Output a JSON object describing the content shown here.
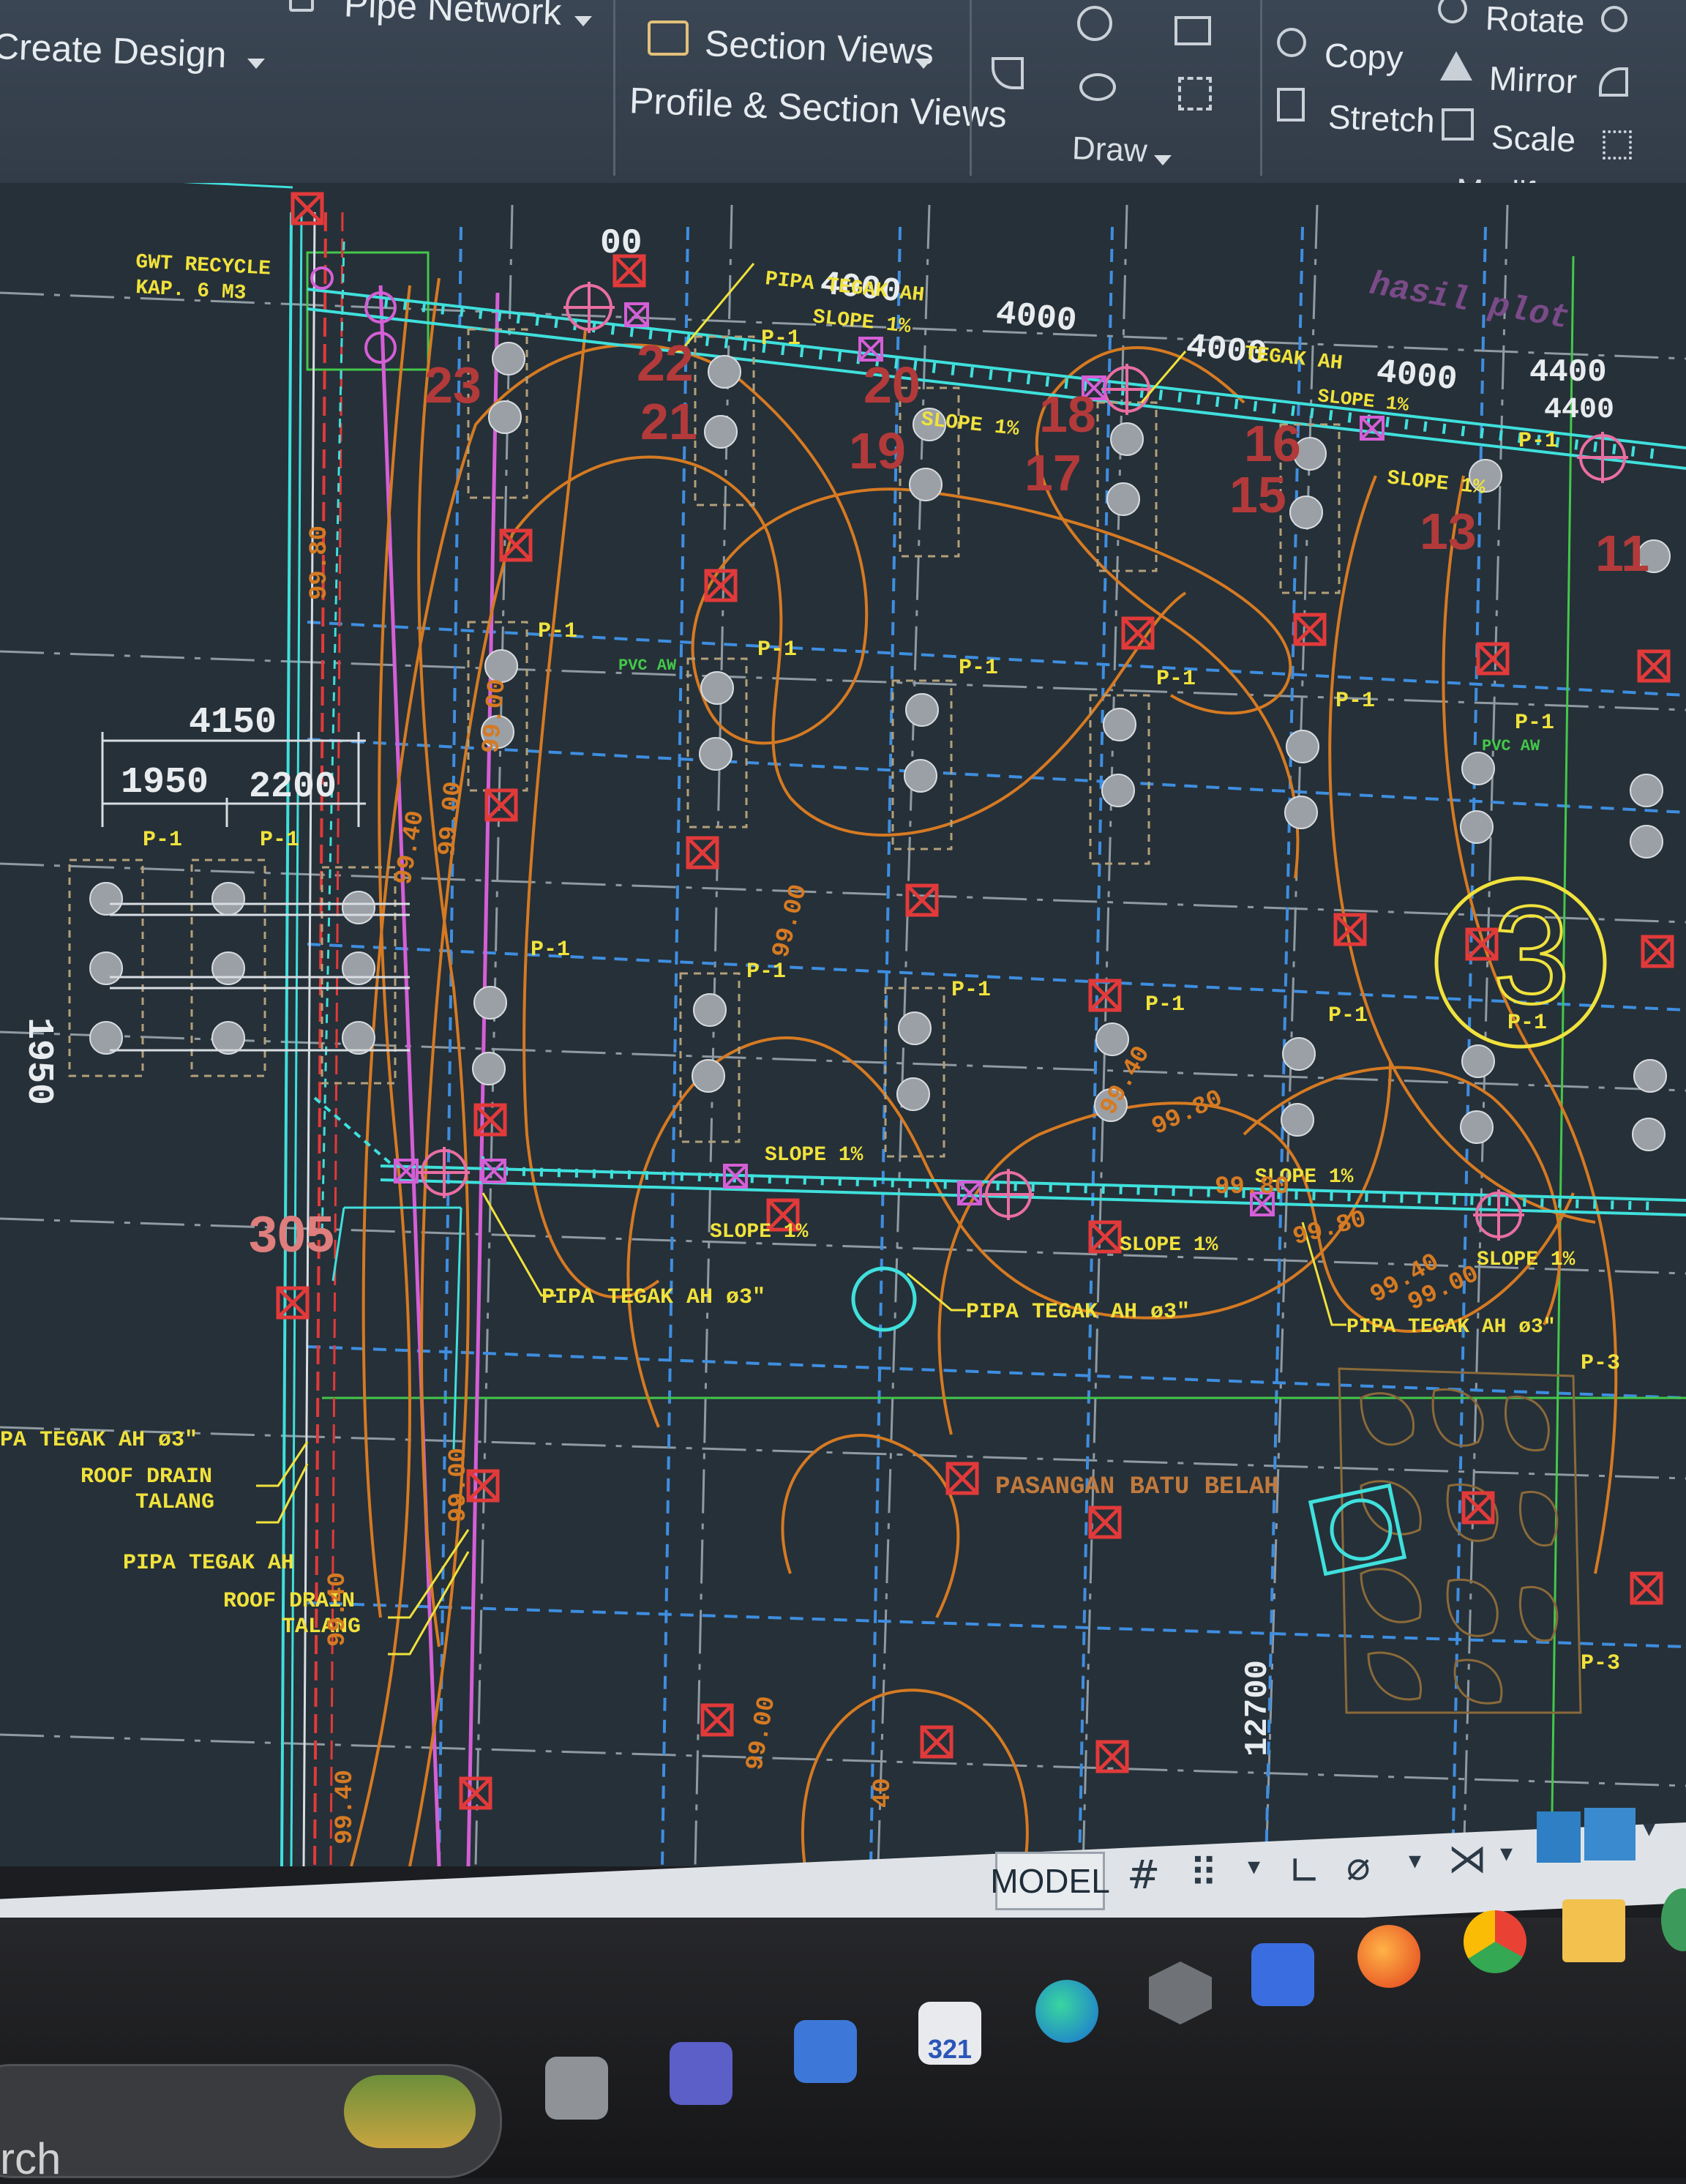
{
  "ribbon": {
    "create_design": "Create Design",
    "pipe_network": "Pipe Network",
    "section_views": "Section Views",
    "profile_section_views": "Profile & Section Views",
    "draw_panel": "Draw",
    "copy": "Copy",
    "stretch": "Stretch",
    "rotate": "Rotate",
    "mirror": "Mirror",
    "scale": "Scale",
    "modify_panel": "Modify"
  },
  "drawing": {
    "gwt_label_1": "GWT RECYCLE",
    "gwt_label_2": "KAP. 6 M3",
    "dim_4150": "4150",
    "dim_1950": "1950",
    "dim_2200": "2200",
    "dim_1950_vertical": "1950",
    "dim_4000_a": "4000",
    "dim_4000_b": "4000",
    "dim_4000_c": "4000",
    "dim_4000_d": "4000",
    "dim_4400": "4400",
    "dim_4400_b": "4400",
    "dim_12700": "12700",
    "top_pipe_label": "PIPA TEGAK AH",
    "top_pipe_label_2": "TEGAK AH",
    "slope_1": "SLOPE 1%",
    "slope_2": "SLOPE 1%",
    "slope_3": "SLOPE 1%",
    "slope_4": "SLOPE 1%",
    "slope_5": "SLOPE 1%",
    "slope_6": "SLOPE 1%",
    "slope_7": "SLOPE 1%",
    "slope_8": "SLOPE 1%",
    "slope_9": "SLOPE 1%",
    "pipa_tegak_1": "PIPA TEGAK AH ø3\"",
    "pipa_tegak_2": "PIPA TEGAK AH ø3\"",
    "pipa_tegak_3": "PIPA TEGAK AH ø3\"",
    "pipa_tegak_left": "PA TEGAK AH ø3\"",
    "roof_drain_1": "ROOF DRAIN",
    "talang_1": "TALANG",
    "pipa_tegak_left_2": "PIPA TEGAK AH",
    "roof_drain_2": "ROOF DRAIN",
    "talang_2": "TALANG",
    "pasangan": "PASANGAN BATU BELAH",
    "hasil_plot": "hasil plot",
    "pvc_label": "PVC AW",
    "pvc_label_2": "PVC AW",
    "pile_label": "P-1",
    "pile_label_b": "P-3",
    "contour_99_80": "99.80",
    "contour_99_40": "99.40",
    "contour_99_00": "99.00",
    "contour_99_00_b": "99.00",
    "contour_99_00_c": "99.00",
    "contour_99_00_d": "99.00",
    "contour_99_40_b": "99.40",
    "contour_99_40_c": "99.40",
    "contour_99_40_d": "99.40",
    "contour_99_80_b": "99.80",
    "contour_99_80_c": "99.80",
    "contour_99_80_d": "99.80",
    "contour_99_40_e": "99.40",
    "contour_99_00_e": "99.00",
    "contour_99_00_f": "99.00",
    "contour_40": "40",
    "grid_num_305": "305",
    "grid_num_21": "21",
    "grid_num_19": "19",
    "grid_num_17": "17",
    "grid_num_13": "13",
    "grid_num_20": "20",
    "grid_num_23": "23",
    "grid_num_18": "18",
    "grid_num_15": "15",
    "grid_num_16": "16",
    "grid_num_11": "11",
    "grid_num_22": "22",
    "number_3": "3",
    "top_00": "00"
  },
  "status": {
    "model": "MODEL"
  },
  "taskbar": {
    "search_partial": "rch",
    "calendar_number": "321"
  },
  "colors": {
    "background": "#263038",
    "contour": "#d67a22",
    "grid": "#3e8ee0",
    "pipe": "#3fe0dc",
    "label": "#f0e23c",
    "red_marker": "#e23a3a",
    "magenta": "#d45fd6"
  }
}
